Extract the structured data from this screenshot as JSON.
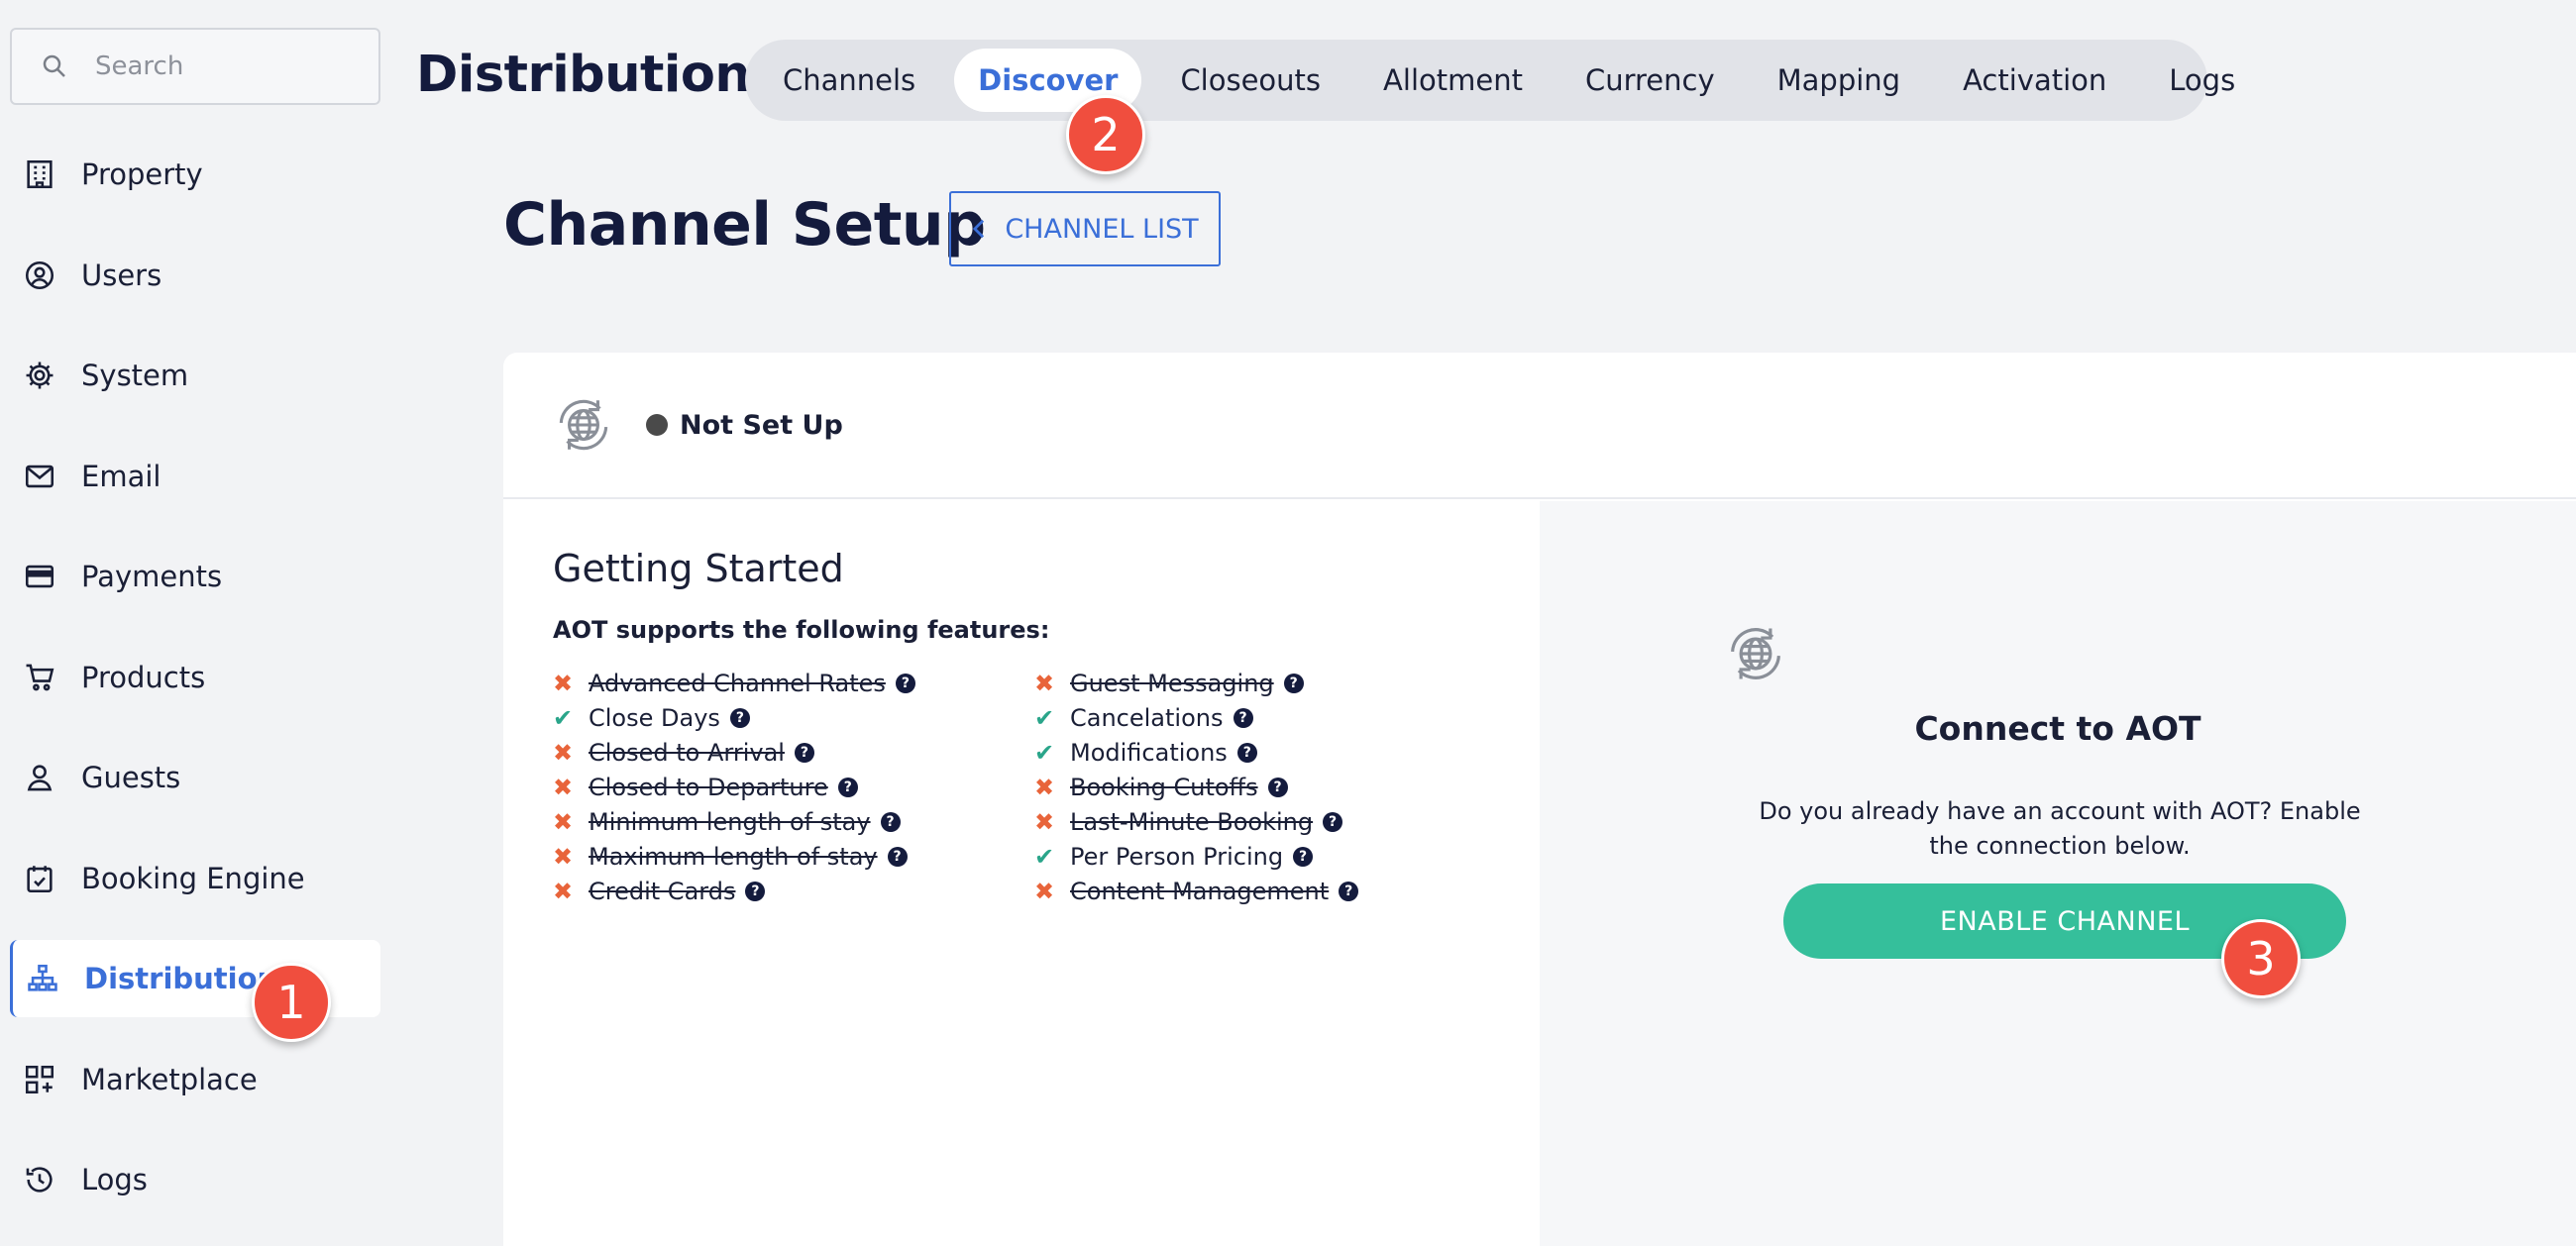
{
  "search": {
    "placeholder": "Search"
  },
  "sidebar": {
    "items": [
      {
        "label": "Property",
        "icon": "building-icon"
      },
      {
        "label": "Users",
        "icon": "user-circle-icon"
      },
      {
        "label": "System",
        "icon": "gear-icon"
      },
      {
        "label": "Email",
        "icon": "envelope-icon"
      },
      {
        "label": "Payments",
        "icon": "credit-card-icon"
      },
      {
        "label": "Products",
        "icon": "cart-icon"
      },
      {
        "label": "Guests",
        "icon": "person-icon"
      },
      {
        "label": "Booking Engine",
        "icon": "calendar-check-icon"
      },
      {
        "label": "Distribution",
        "icon": "sitemap-icon",
        "active": true
      },
      {
        "label": "Marketplace",
        "icon": "grid-plus-icon"
      },
      {
        "label": "Logs",
        "icon": "history-icon"
      }
    ]
  },
  "header": {
    "title": "Distribution",
    "tabs": [
      "Channels",
      "Discover",
      "Closeouts",
      "Allotment",
      "Currency",
      "Mapping",
      "Activation",
      "Logs"
    ],
    "active_tab": "Discover"
  },
  "page": {
    "title": "Channel Setup",
    "channel_list_label": "CHANNEL LIST"
  },
  "card": {
    "status": "Not Set Up",
    "getting_started": "Getting Started",
    "features_intro": "AOT supports the following features:",
    "features_left": [
      {
        "label": "Advanced Channel Rates",
        "supported": false
      },
      {
        "label": "Close Days",
        "supported": true
      },
      {
        "label": "Closed to Arrival",
        "supported": false
      },
      {
        "label": "Closed to Departure",
        "supported": false
      },
      {
        "label": "Minimum length of stay",
        "supported": false
      },
      {
        "label": "Maximum length of stay",
        "supported": false
      },
      {
        "label": "Credit Cards",
        "supported": false
      }
    ],
    "features_right": [
      {
        "label": "Guest Messaging",
        "supported": false
      },
      {
        "label": "Cancelations",
        "supported": true
      },
      {
        "label": "Modifications",
        "supported": true
      },
      {
        "label": "Booking Cutoffs",
        "supported": false
      },
      {
        "label": "Last-Minute Booking",
        "supported": false
      },
      {
        "label": "Per Person Pricing",
        "supported": true
      },
      {
        "label": "Content Management",
        "supported": false
      }
    ],
    "connect_title": "Connect to AOT",
    "connect_desc": "Do you already have an account with AOT? Enable the connection below.",
    "enable_label": "ENABLE CHANNEL"
  },
  "annotations": {
    "badge1": "1",
    "badge2": "2",
    "badge3": "3"
  },
  "colors": {
    "accent": "#3b6fd8",
    "enable": "#35bf9b",
    "badge": "#f04e3e",
    "cross": "#e8643a",
    "check": "#2aa58a"
  }
}
